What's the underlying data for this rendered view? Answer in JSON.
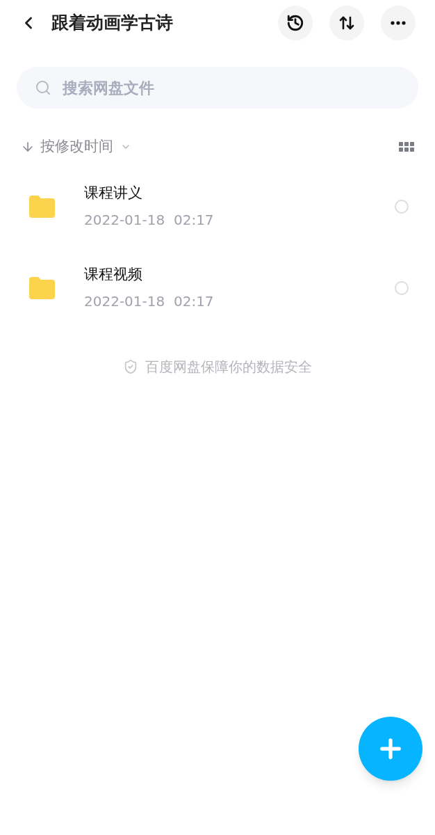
{
  "header": {
    "title": "跟着动画学古诗"
  },
  "search": {
    "placeholder": "搜索网盘文件"
  },
  "sort": {
    "label": "按修改时间"
  },
  "files": [
    {
      "name": "课程讲义",
      "modified": "2022-01-18  02:17",
      "selected": false
    },
    {
      "name": "课程视频",
      "modified": "2022-01-18  02:17",
      "selected": false
    }
  ],
  "footer_note": "百度网盘保障你的数据安全"
}
